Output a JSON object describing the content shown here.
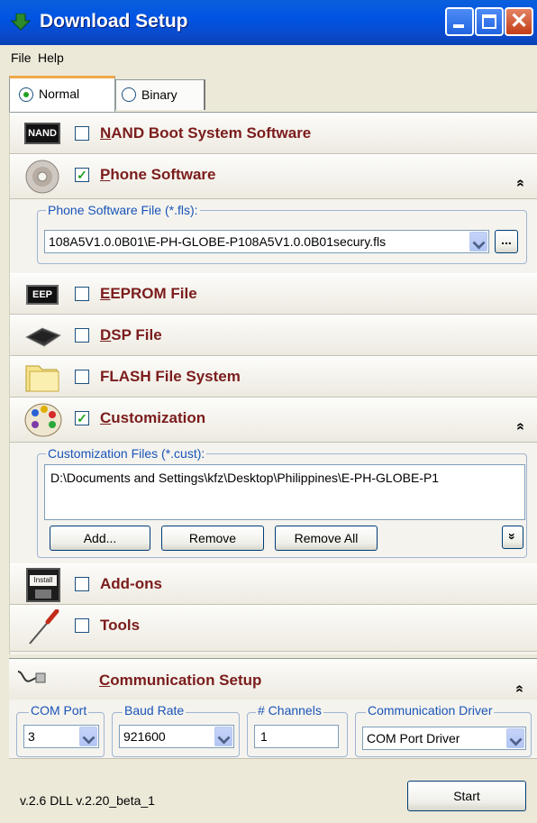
{
  "window": {
    "title": "Download Setup",
    "app_icon": "download-arrow-icon"
  },
  "menu": {
    "file": "File",
    "help": "Help"
  },
  "tabs": [
    {
      "label": "Normal",
      "selected": true
    },
    {
      "label": "Binary",
      "selected": false
    }
  ],
  "sections": {
    "nand": {
      "label": "NAND Boot System Software",
      "checked": false,
      "icon_text": "NAND"
    },
    "phone": {
      "label": "Phone Software",
      "checked": true,
      "collapse_glyph": "»",
      "group_label": "Phone Software File (*.fls):",
      "file_value": "108A5V1.0.0B01\\E-PH-GLOBE-P108A5V1.0.0B01secury.fls",
      "browse_label": "..."
    },
    "eeprom": {
      "label": "EEPROM File",
      "checked": false,
      "icon_text": "EEP"
    },
    "dsp": {
      "label": "DSP File",
      "checked": false
    },
    "flash": {
      "label": "FLASH File System",
      "checked": false
    },
    "custom": {
      "label": "Customization",
      "checked": true,
      "collapse_glyph": "»",
      "group_label": "Customization Files (*.cust):",
      "files": [
        "D:\\Documents and Settings\\kfz\\Desktop\\Philippines\\E-PH-GLOBE-P1"
      ],
      "add_label": "Add...",
      "remove_label": "Remove",
      "remove_all_label": "Remove All",
      "expand_glyph": "»"
    },
    "addons": {
      "label": "Add-ons",
      "checked": false,
      "icon_text": "Install"
    },
    "tools": {
      "label": "Tools",
      "checked": false
    }
  },
  "communication": {
    "title": "Communication Setup",
    "collapse_glyph": "»",
    "com_port": {
      "label": "COM Port",
      "value": "3"
    },
    "baud_rate": {
      "label": "Baud Rate",
      "value": "921600"
    },
    "channels": {
      "label": "# Channels",
      "value": "1"
    },
    "driver": {
      "label": "Communication Driver",
      "value": "COM Port Driver"
    }
  },
  "footer": {
    "version": "v.2.6 DLL v.2.20_beta_1",
    "start_label": "Start"
  },
  "colors": {
    "section_label": "#7b1c1c",
    "group_label": "#1a54b8",
    "titlebar": "#0054e3"
  }
}
